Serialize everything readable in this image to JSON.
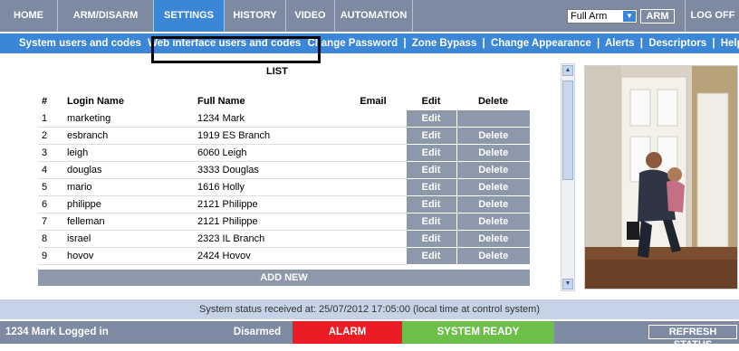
{
  "nav": {
    "tabs": [
      "HOME",
      "ARM/DISARM",
      "SETTINGS",
      "HISTORY",
      "VIDEO",
      "AUTOMATION"
    ],
    "active_tab": "SETTINGS",
    "arm_mode_selected": "Full Arm",
    "arm_button": "ARM",
    "logoff": "LOG OFF"
  },
  "subnav": {
    "items": [
      "System users and codes",
      "Web interface users and codes",
      "Change Password",
      "Zone Bypass",
      "Change Appearance",
      "Alerts",
      "Descriptors",
      "Help"
    ],
    "separator": "|"
  },
  "list": {
    "title": "LIST",
    "columns": [
      "#",
      "Login Name",
      "Full Name",
      "Email",
      "Edit",
      "Delete"
    ],
    "rows": [
      {
        "num": "1",
        "login": "marketing",
        "full": "1234 Mark",
        "email": "",
        "edit": "Edit",
        "delete": ""
      },
      {
        "num": "2",
        "login": "esbranch",
        "full": "1919 ES Branch",
        "email": "",
        "edit": "Edit",
        "delete": "Delete"
      },
      {
        "num": "3",
        "login": "leigh",
        "full": "6060 Leigh",
        "email": "",
        "edit": "Edit",
        "delete": "Delete"
      },
      {
        "num": "4",
        "login": "douglas",
        "full": "3333 Douglas",
        "email": "",
        "edit": "Edit",
        "delete": "Delete"
      },
      {
        "num": "5",
        "login": "mario",
        "full": "1616 Holly",
        "email": "",
        "edit": "Edit",
        "delete": "Delete"
      },
      {
        "num": "6",
        "login": "philippe",
        "full": "2121 Philippe",
        "email": "",
        "edit": "Edit",
        "delete": "Delete"
      },
      {
        "num": "7",
        "login": "felleman",
        "full": "2121 Philippe",
        "email": "",
        "edit": "Edit",
        "delete": "Delete"
      },
      {
        "num": "8",
        "login": "israel",
        "full": "2323 IL Branch",
        "email": "",
        "edit": "Edit",
        "delete": "Delete"
      },
      {
        "num": "9",
        "login": "hovov",
        "full": "2424 Hovov",
        "email": "",
        "edit": "Edit",
        "delete": "Delete"
      }
    ],
    "add_new": "ADD NEW"
  },
  "status": {
    "received": "System status received at: 25/07/2012 17:05:00 (local time at control system)",
    "logged_in": "1234 Mark Logged in",
    "arm_state": "Disarmed",
    "alarm": "ALARM",
    "system_ready": "SYSTEM READY",
    "refresh": "REFRESH STATUS"
  },
  "colors": {
    "nav_bg": "#7e8aa2",
    "accent_blue": "#3b86d6",
    "grid_cell": "#8e98ab",
    "alarm_red": "#ec1c24",
    "ready_green": "#6cc04a"
  }
}
